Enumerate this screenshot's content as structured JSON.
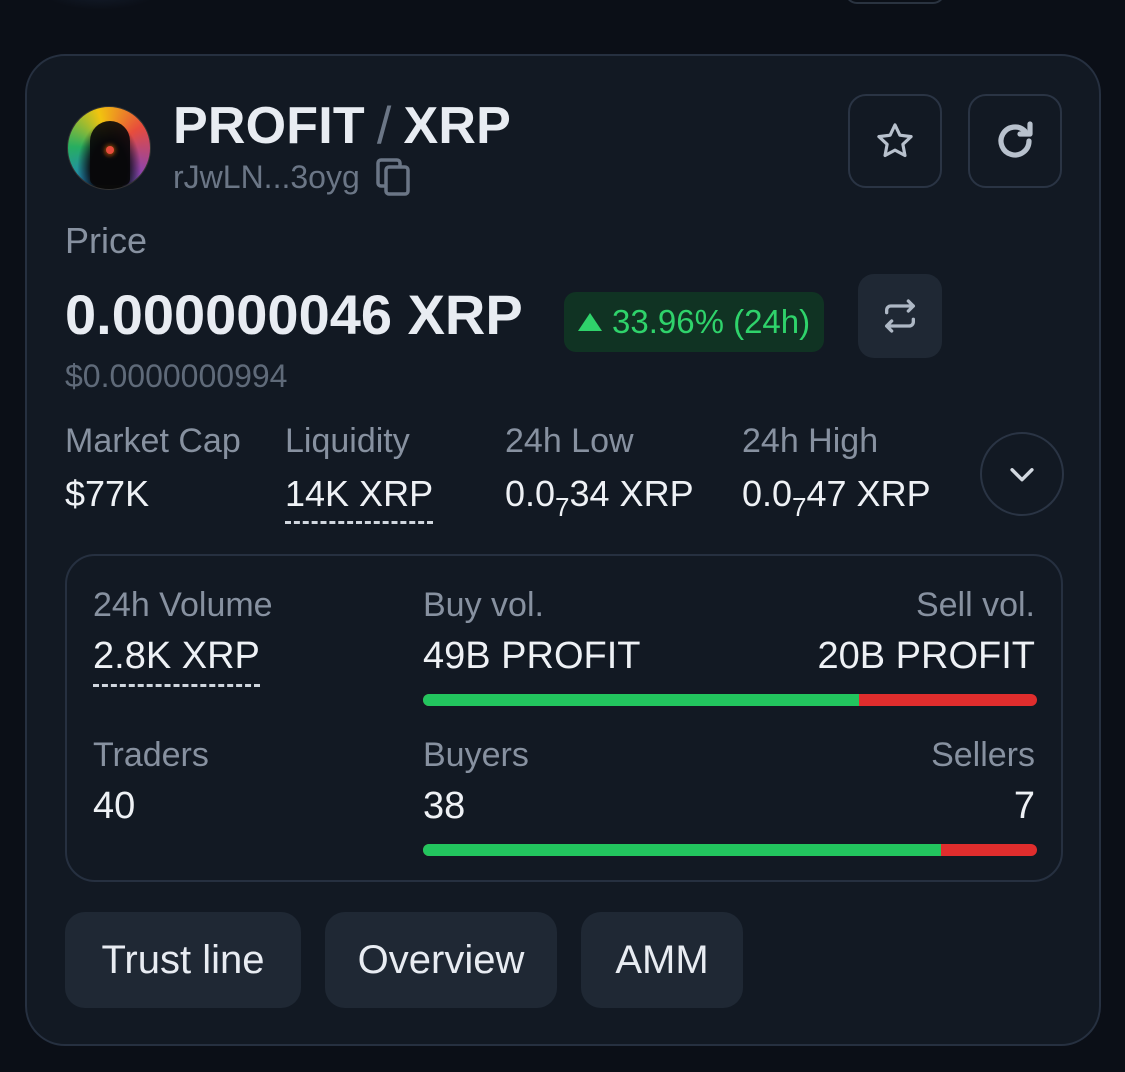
{
  "header": {
    "base_symbol": "PROFIT",
    "separator": "/",
    "quote_symbol": "XRP",
    "address_short": "rJwLN...3oyg",
    "icons": {
      "copy": "copy-icon",
      "favorite": "star-icon",
      "refresh": "refresh-icon"
    }
  },
  "price": {
    "label": "Price",
    "value": "0.000000046 XRP",
    "change": "33.96% (24h)",
    "usd_value": "$0.0000000994",
    "swap_icon": "swap-arrows-icon"
  },
  "stats": {
    "market_cap": {
      "label": "Market Cap",
      "value": "$77K"
    },
    "liquidity": {
      "label": "Liquidity",
      "value": "14K XRP"
    },
    "low_24h": {
      "label": "24h Low",
      "prefix": "0.0",
      "zeros": "7",
      "suffix": "34 XRP"
    },
    "high_24h": {
      "label": "24h High",
      "prefix": "0.0",
      "zeros": "7",
      "suffix": "47 XRP"
    },
    "expand_icon": "chevron-down-icon"
  },
  "volume": {
    "volume_24h": {
      "label": "24h Volume",
      "value": "2.8K XRP"
    },
    "buy_vol": {
      "label": "Buy vol.",
      "value": "49B PROFIT"
    },
    "sell_vol": {
      "label": "Sell vol.",
      "value": "20B PROFIT"
    },
    "buy_vol_share": 0.71,
    "traders": {
      "label": "Traders",
      "value": "40"
    },
    "buyers": {
      "label": "Buyers",
      "value": "38"
    },
    "sellers": {
      "label": "Sellers",
      "value": "7"
    },
    "buyers_share": 0.844
  },
  "tabs": [
    {
      "label": "Trust line"
    },
    {
      "label": "Overview"
    },
    {
      "label": "AMM"
    }
  ],
  "colors": {
    "positive": "#22c55e",
    "negative": "#e02d2d",
    "background": "#0b0f17",
    "card": "#121923"
  }
}
